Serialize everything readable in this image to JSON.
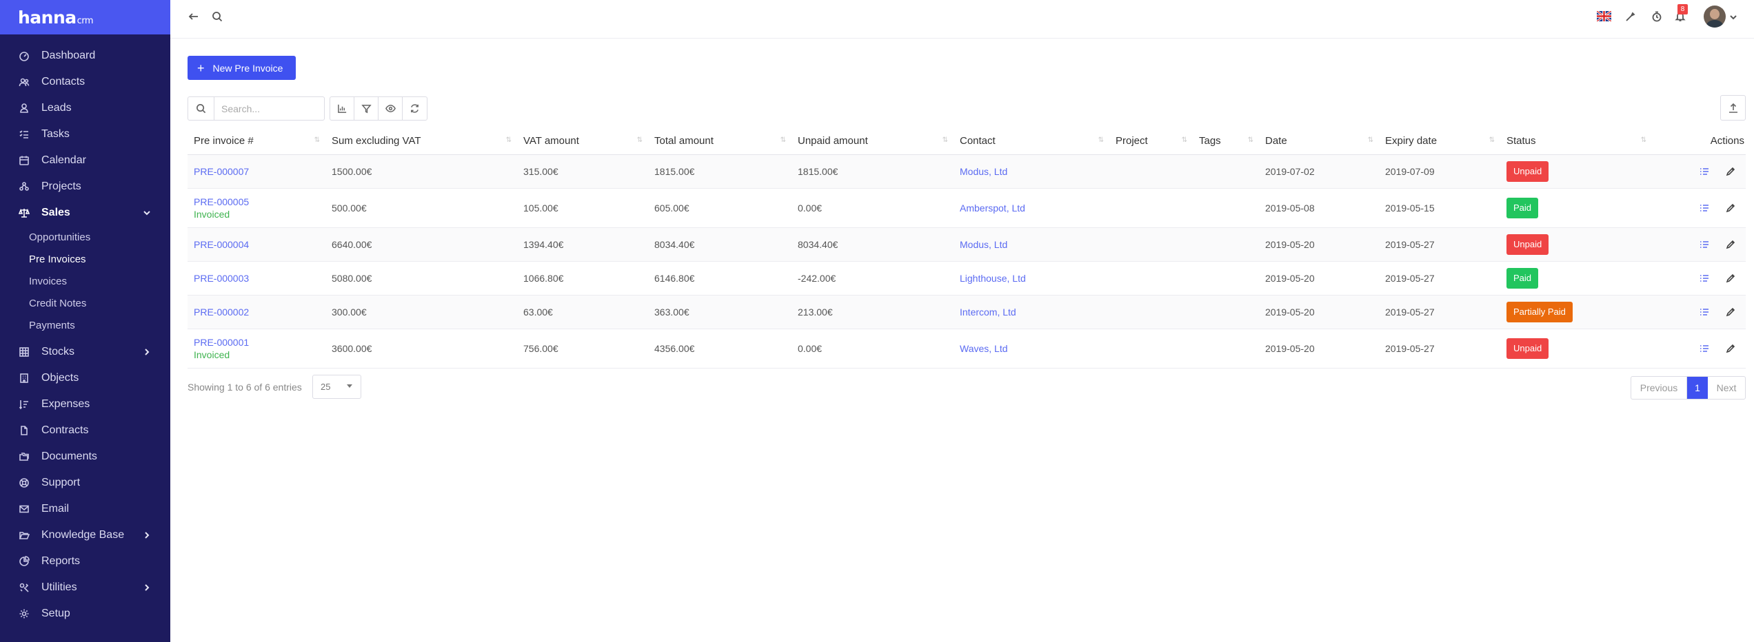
{
  "brand": {
    "name": "hanna",
    "suffix": "crm"
  },
  "sidebar": {
    "items": [
      {
        "label": "Dashboard",
        "icon": "dashboard-icon"
      },
      {
        "label": "Contacts",
        "icon": "users-icon"
      },
      {
        "label": "Leads",
        "icon": "leads-icon"
      },
      {
        "label": "Tasks",
        "icon": "tasks-icon"
      },
      {
        "label": "Calendar",
        "icon": "calendar-icon"
      },
      {
        "label": "Projects",
        "icon": "projects-icon"
      },
      {
        "label": "Sales",
        "icon": "scale-icon",
        "expanded": true
      },
      {
        "label": "Stocks",
        "icon": "grid-icon",
        "has_children": true
      },
      {
        "label": "Objects",
        "icon": "building-icon"
      },
      {
        "label": "Expenses",
        "icon": "expenses-icon"
      },
      {
        "label": "Contracts",
        "icon": "file-icon"
      },
      {
        "label": "Documents",
        "icon": "folders-icon"
      },
      {
        "label": "Support",
        "icon": "lifebuoy-icon"
      },
      {
        "label": "Email",
        "icon": "mail-icon"
      },
      {
        "label": "Knowledge Base",
        "icon": "folder-open-icon",
        "has_children": true
      },
      {
        "label": "Reports",
        "icon": "pie-chart-icon"
      },
      {
        "label": "Utilities",
        "icon": "tools-icon",
        "has_children": true
      },
      {
        "label": "Setup",
        "icon": "gear-icon"
      }
    ],
    "sales_sub": [
      {
        "label": "Opportunities"
      },
      {
        "label": "Pre Invoices",
        "active": true
      },
      {
        "label": "Invoices"
      },
      {
        "label": "Credit Notes"
      },
      {
        "label": "Payments"
      }
    ]
  },
  "topbar": {
    "notification_count": "8",
    "language_flag": "uk-flag-icon"
  },
  "main": {
    "new_button_label": "New Pre Invoice",
    "search_placeholder": "Search...",
    "columns": [
      "Pre invoice #",
      "Sum excluding VAT",
      "VAT amount",
      "Total amount",
      "Unpaid amount",
      "Contact",
      "Project",
      "Tags",
      "Date",
      "Expiry date",
      "Status",
      "Actions"
    ],
    "rows": [
      {
        "number": "PRE-000007",
        "invoiced": "",
        "sum": "1500.00€",
        "vat": "315.00€",
        "total": "1815.00€",
        "unpaid": "1815.00€",
        "contact": "Modus, Ltd",
        "project": "",
        "tags": "",
        "date": "2019-07-02",
        "expiry": "2019-07-09",
        "status": "Unpaid",
        "status_color": "#ef4444"
      },
      {
        "number": "PRE-000005",
        "invoiced": "Invoiced",
        "sum": "500.00€",
        "vat": "105.00€",
        "total": "605.00€",
        "unpaid": "0.00€",
        "contact": "Amberspot, Ltd",
        "project": "",
        "tags": "",
        "date": "2019-05-08",
        "expiry": "2019-05-15",
        "status": "Paid",
        "status_color": "#22c55e"
      },
      {
        "number": "PRE-000004",
        "invoiced": "",
        "sum": "6640.00€",
        "vat": "1394.40€",
        "total": "8034.40€",
        "unpaid": "8034.40€",
        "contact": "Modus, Ltd",
        "project": "",
        "tags": "",
        "date": "2019-05-20",
        "expiry": "2019-05-27",
        "status": "Unpaid",
        "status_color": "#ef4444"
      },
      {
        "number": "PRE-000003",
        "invoiced": "",
        "sum": "5080.00€",
        "vat": "1066.80€",
        "total": "6146.80€",
        "unpaid": "-242.00€",
        "contact": "Lighthouse, Ltd",
        "project": "",
        "tags": "",
        "date": "2019-05-20",
        "expiry": "2019-05-27",
        "status": "Paid",
        "status_color": "#22c55e"
      },
      {
        "number": "PRE-000002",
        "invoiced": "",
        "sum": "300.00€",
        "vat": "63.00€",
        "total": "363.00€",
        "unpaid": "213.00€",
        "contact": "Intercom, Ltd",
        "project": "",
        "tags": "",
        "date": "2019-05-20",
        "expiry": "2019-05-27",
        "status": "Partially Paid",
        "status_color": "#ea6a0c"
      },
      {
        "number": "PRE-000001",
        "invoiced": "Invoiced",
        "sum": "3600.00€",
        "vat": "756.00€",
        "total": "4356.00€",
        "unpaid": "0.00€",
        "contact": "Waves, Ltd",
        "project": "",
        "tags": "",
        "date": "2019-05-20",
        "expiry": "2019-05-27",
        "status": "Unpaid",
        "status_color": "#ef4444"
      }
    ],
    "showing_text": "Showing 1 to 6 of 6 entries",
    "per_page": "25",
    "pagination": {
      "prev": "Previous",
      "current": "1",
      "next": "Next"
    }
  }
}
